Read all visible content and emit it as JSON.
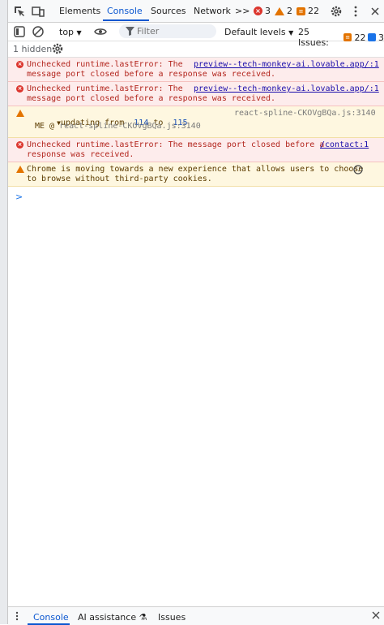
{
  "tabs": {
    "elements": "Elements",
    "console": "Console",
    "sources": "Sources",
    "network": "Network",
    "more": ">>"
  },
  "counts": {
    "errors": "3",
    "warnings": "2",
    "issues": "22"
  },
  "toolbar": {
    "context": "top",
    "filter_placeholder": "Filter",
    "levels": "Default levels",
    "issues_label": "25 Issues:",
    "issues_count": "22",
    "info_count": "3"
  },
  "hidden": "1 hidden",
  "messages": [
    {
      "type": "error",
      "text": "Unchecked runtime.lastError: The\nmessage port closed before a response was received.",
      "source": "preview--tech-monkey-ai.lovable.app/:1"
    },
    {
      "type": "error",
      "text": "Unchecked runtime.lastError: The\nmessage port closed before a response was received.",
      "source": "preview--tech-monkey-ai.lovable.app/:1"
    },
    {
      "type": "warning",
      "prefix": "updating from",
      "from": "114",
      "to_word": "to",
      "to": "115",
      "source": "react-spline-CKOVgBQa.js:3140",
      "line2_prefix": "ME @",
      "line2_link": "react-spline-CKOVgBQa.js:3140"
    },
    {
      "type": "error",
      "text": "Unchecked runtime.lastError: The message port closed before a\nresponse was received.",
      "source": "/contact:1"
    },
    {
      "type": "warning",
      "text": "Chrome is moving towards a new experience that allows users to choose\nto browse without third-party cookies."
    }
  ],
  "prompt": ">",
  "drawer": {
    "console": "Console",
    "ai": "AI assistance",
    "issues": "Issues"
  },
  "colors": {
    "accent": "#0b57d0",
    "error": "#dc362e",
    "warning": "#e37400"
  }
}
